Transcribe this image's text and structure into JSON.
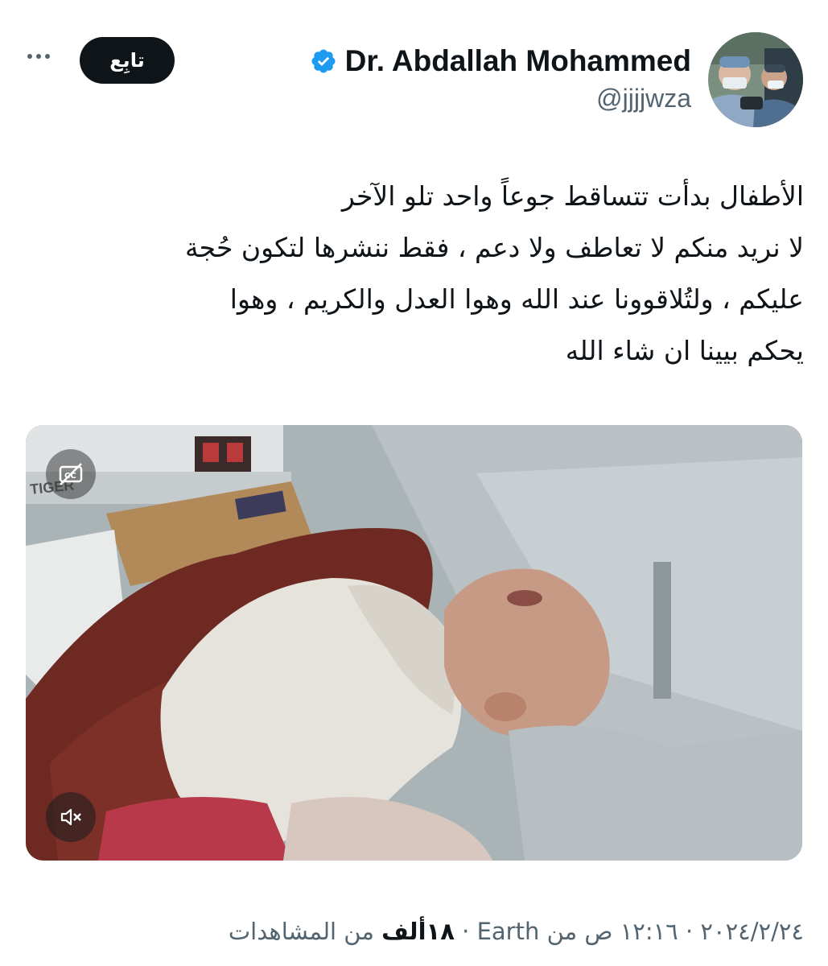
{
  "header": {
    "display_name": "Dr. Abdallah Mohammed",
    "handle": "@jjjjwza",
    "follow_label": "تابِع",
    "verified": true,
    "avatar_icon": "avatar-photo"
  },
  "tweet": {
    "lines": [
      "الأطفال بدأت تتساقط جوعاً واحد تلو الآخر",
      "لا نريد منكم لا تعاطف ولا دعم ، فقط ننشرها لتكون حُجة",
      "عليكم ، ولتُلاقوونا عند الله وهوا العدل والكريم ، وهوا",
      "يحكم بيينا ان شاء الله"
    ]
  },
  "media": {
    "captions_icon": "captions-off-icon",
    "mute_icon": "speaker-muted-icon",
    "box_label": "TIGER"
  },
  "meta": {
    "time": "١٢:١٦ ص",
    "date": "٢٠٢٤/٢/٢٤",
    "source": "من Earth",
    "views_count": "١٨ألف",
    "views_label": "من المشاهدات",
    "separator": "·"
  },
  "colors": {
    "text": "#0f1419",
    "secondary": "#536471",
    "verified": "#1d9bf0",
    "button": "#0f1419"
  }
}
